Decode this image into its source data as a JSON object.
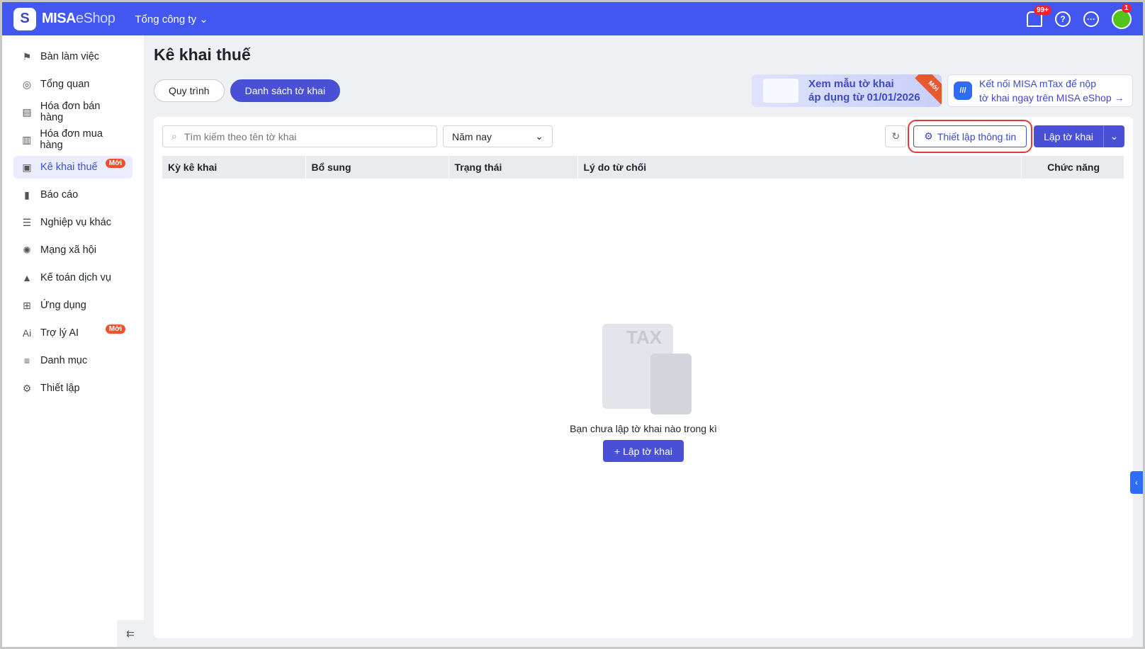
{
  "header": {
    "logo_letter": "S",
    "brand_bold": "MISA",
    "brand_light": "eShop",
    "org": "Tổng công ty",
    "notif_count": "99+",
    "help": "?",
    "more": "···",
    "avatar_badge": "1"
  },
  "sidebar": {
    "items": [
      {
        "label": "Bàn làm việc",
        "icon": "⚑"
      },
      {
        "label": "Tổng quan",
        "icon": "◎"
      },
      {
        "label": "Hóa đơn bán hàng",
        "icon": "▤"
      },
      {
        "label": "Hóa đơn mua hàng",
        "icon": "▥"
      },
      {
        "label": "Kê khai thuế",
        "icon": "▣",
        "badge": "Mới"
      },
      {
        "label": "Báo cáo",
        "icon": "▮"
      },
      {
        "label": "Nghiệp vụ khác",
        "icon": "☰"
      },
      {
        "label": "Mạng xã hội",
        "icon": "✺"
      },
      {
        "label": "Kế toán dịch vụ",
        "icon": "▲"
      },
      {
        "label": "Ứng dụng",
        "icon": "⊞"
      },
      {
        "label": "Trợ lý AI",
        "icon": "Ai",
        "badge": "Mới"
      },
      {
        "label": "Danh mục",
        "icon": "≡"
      },
      {
        "label": "Thiết lập",
        "icon": "⚙"
      }
    ],
    "collapse": "⇇"
  },
  "page": {
    "title": "Kê khai thuế",
    "tabs": [
      "Quy trình",
      "Danh sách tờ khai"
    ],
    "banner1": {
      "line1": "Xem mẫu tờ khai",
      "line2": "áp dụng từ 01/01/2026",
      "tag": "Mới"
    },
    "banner2": {
      "line1": "Kết nối MISA mTax để nộp",
      "line2": "tờ khai ngay trên MISA eShop →"
    }
  },
  "toolbar": {
    "search_placeholder": "Tìm kiếm theo tên tờ khai",
    "period": "Năm nay",
    "setup": "Thiết lập thông tin",
    "create": "Lập tờ khai"
  },
  "table": {
    "columns": [
      "Kỳ kê khai",
      "Bổ sung",
      "Trạng thái",
      "Lý do từ chối",
      "Chức năng"
    ]
  },
  "empty": {
    "tax": "TAX",
    "message": "Bạn chưa lập tờ khai nào trong kì",
    "button": "+ Lập tờ khai"
  }
}
